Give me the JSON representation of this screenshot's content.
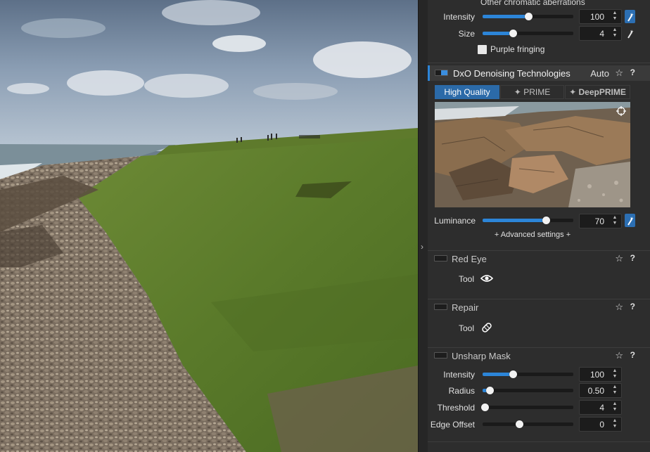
{
  "chromatic": {
    "section_title": "Other chromatic aberrations",
    "intensity": {
      "label": "Intensity",
      "value": "100",
      "level": 0.5
    },
    "size": {
      "label": "Size",
      "value": "4",
      "level": 0.33
    },
    "purple_fringing_label": "Purple fringing"
  },
  "denoise": {
    "title": "DxO Denoising Technologies",
    "auto_label": "Auto",
    "tabs": [
      "High Quality",
      "PRIME",
      "DeepPRIME"
    ],
    "luminance": {
      "label": "Luminance",
      "value": "70",
      "level": 0.7
    },
    "advanced_label": "+ Advanced settings +"
  },
  "red_eye": {
    "title": "Red Eye",
    "tool_label": "Tool"
  },
  "repair": {
    "title": "Repair",
    "tool_label": "Tool"
  },
  "unsharp": {
    "title": "Unsharp Mask",
    "intensity": {
      "label": "Intensity",
      "value": "100",
      "level": 0.33
    },
    "radius": {
      "label": "Radius",
      "value": "0.50",
      "level": 0.08
    },
    "threshold": {
      "label": "Threshold",
      "value": "4",
      "level": 0.02
    },
    "edge_offset": {
      "label": "Edge Offset",
      "value": "0",
      "level": 0.4
    }
  },
  "icons": {
    "star": "star-icon",
    "help": "help-icon",
    "wand": "magic-wand-icon",
    "eye": "eye-icon",
    "bandage": "bandage-icon",
    "crosshair": "crosshair-icon",
    "collapse": "chevron-right-icon"
  },
  "colors": {
    "accent": "#2c85d8",
    "tab_selected": "#2b6aa8",
    "panel": "#2d2d2d"
  }
}
